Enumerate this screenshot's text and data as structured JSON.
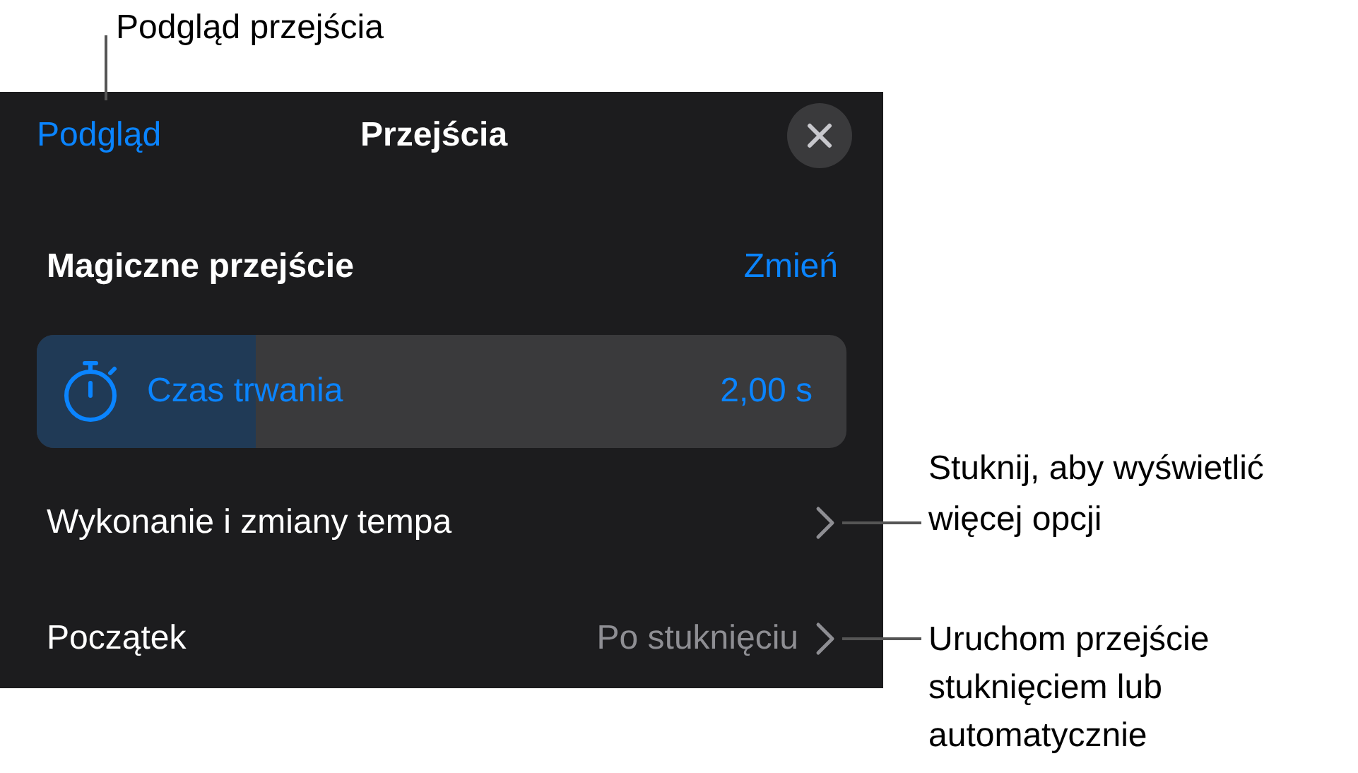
{
  "callouts": [
    {
      "text": "Podgląd przejścia"
    },
    {
      "text": "Stuknij, aby wyświetlić więcej opcji"
    },
    {
      "text": "Uruchom przejście stuknięciem lub automatycznie"
    }
  ],
  "panel": {
    "preview_button": "Podgląd",
    "title": "Przejścia",
    "effect": {
      "label": "Magiczne przejście",
      "action": "Zmień"
    },
    "duration": {
      "label": "Czas trwania",
      "value": "2,00 s",
      "level": 0.27
    },
    "rows": [
      {
        "label": "Wykonanie i zmiany tempa"
      },
      {
        "label": "Początek",
        "value": "Po stuknięciu"
      }
    ]
  }
}
